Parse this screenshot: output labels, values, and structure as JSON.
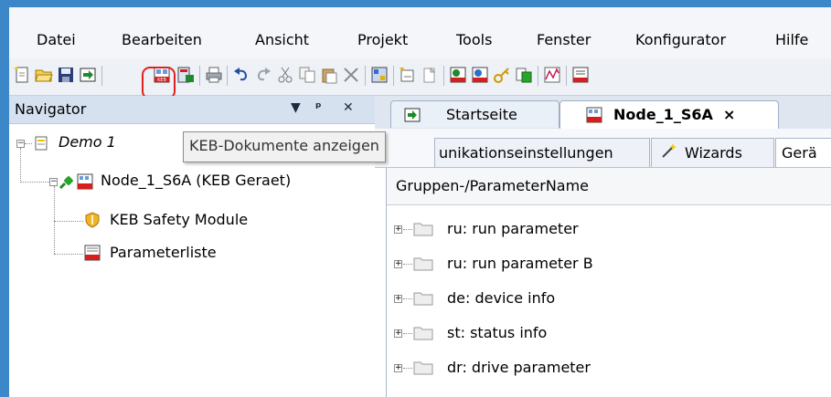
{
  "menu": {
    "items": [
      "Datei",
      "Bearbeiten",
      "Ansicht",
      "Projekt",
      "Tools",
      "Fenster",
      "Konfigurator",
      "Hilfe"
    ]
  },
  "toolbar": {
    "icons": [
      "new-project-icon",
      "open-folder-icon",
      "save-icon",
      "import-icon",
      "keb-documents-icon",
      "export-icon",
      "print-icon",
      "undo-icon",
      "redo-icon",
      "cut-icon",
      "copy-icon",
      "paste-icon",
      "delete-icon",
      "device-scan-icon",
      "add-node-icon",
      "new-file-icon",
      "keb-online-icon",
      "keb-offline-icon",
      "key-icon",
      "compare-icon",
      "scope-icon",
      "parameter-icon"
    ],
    "highlighted": "keb-documents-icon"
  },
  "tooltip": {
    "text": "KEB-Dokumente anzeigen"
  },
  "navigator": {
    "title": "Navigator",
    "controls": {
      "menu": "▼",
      "pin": "ᵖ",
      "close": "✕"
    },
    "tree": {
      "root": {
        "label": "Demo 1",
        "expander": "−"
      },
      "node": {
        "label": "Node_1_S6A (KEB Geraet)",
        "expander": "−"
      },
      "children": [
        {
          "label": "KEB Safety Module",
          "icon": "safety-shield-icon"
        },
        {
          "label": "Parameterliste",
          "icon": "parameter-list-icon"
        }
      ]
    }
  },
  "tabs": {
    "items": [
      {
        "label": "Startseite",
        "icon": "start-page-icon",
        "active": false
      },
      {
        "label": "Node_1_S6A",
        "icon": "keb-device-icon",
        "active": true,
        "close": "×"
      }
    ]
  },
  "subtabs": {
    "items": [
      {
        "label": "unikationseinstellungen"
      },
      {
        "label": "Wizards",
        "icon": "wand-icon"
      },
      {
        "label": "Gerä"
      }
    ]
  },
  "grid": {
    "column_header": "Gruppen-/ParameterName",
    "rows": [
      {
        "label": "ru: run parameter",
        "expander": "+"
      },
      {
        "label": "ru: run parameter B",
        "expander": "+"
      },
      {
        "label": "de: device info",
        "expander": "+"
      },
      {
        "label": "st: status info",
        "expander": "+"
      },
      {
        "label": "dr: drive parameter",
        "expander": "+"
      }
    ]
  },
  "colors": {
    "frame": "#3b87c8",
    "highlight": "#e02020",
    "nav_header": "#d6e1f0"
  }
}
